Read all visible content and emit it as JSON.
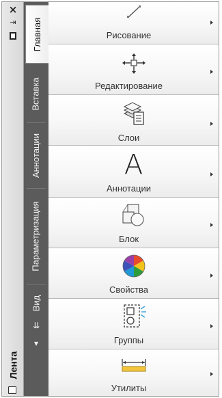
{
  "ribbon": {
    "title": "Лента",
    "close_glyph": "×",
    "pin_glyph": "⇥"
  },
  "tabs": [
    {
      "label": "Главная",
      "active": true
    },
    {
      "label": "Вставка",
      "active": false
    },
    {
      "label": "Аннотации",
      "active": false
    },
    {
      "label": "Параметризация",
      "active": false
    },
    {
      "label": "Вид",
      "active": false
    }
  ],
  "tab_controls": {
    "collapse_glyph": "⇊",
    "options_glyph": "▾"
  },
  "panels": [
    {
      "label": "Рисование",
      "icon": "line-draw-icon"
    },
    {
      "label": "Редактирование",
      "icon": "move-arrows-icon"
    },
    {
      "label": "Слои",
      "icon": "layers-icon"
    },
    {
      "label": "Аннотации",
      "icon": "text-a-icon",
      "glyph": "A"
    },
    {
      "label": "Блок",
      "icon": "block-icon"
    },
    {
      "label": "Свойства",
      "icon": "color-wheel-icon"
    },
    {
      "label": "Группы",
      "icon": "group-icon"
    },
    {
      "label": "Утилиты",
      "icon": "measure-icon"
    }
  ],
  "colors": {
    "tab_strip": "#5b5b5b",
    "title_strip": "#e0e0e0",
    "panel_bg": "#f7f7f7"
  }
}
